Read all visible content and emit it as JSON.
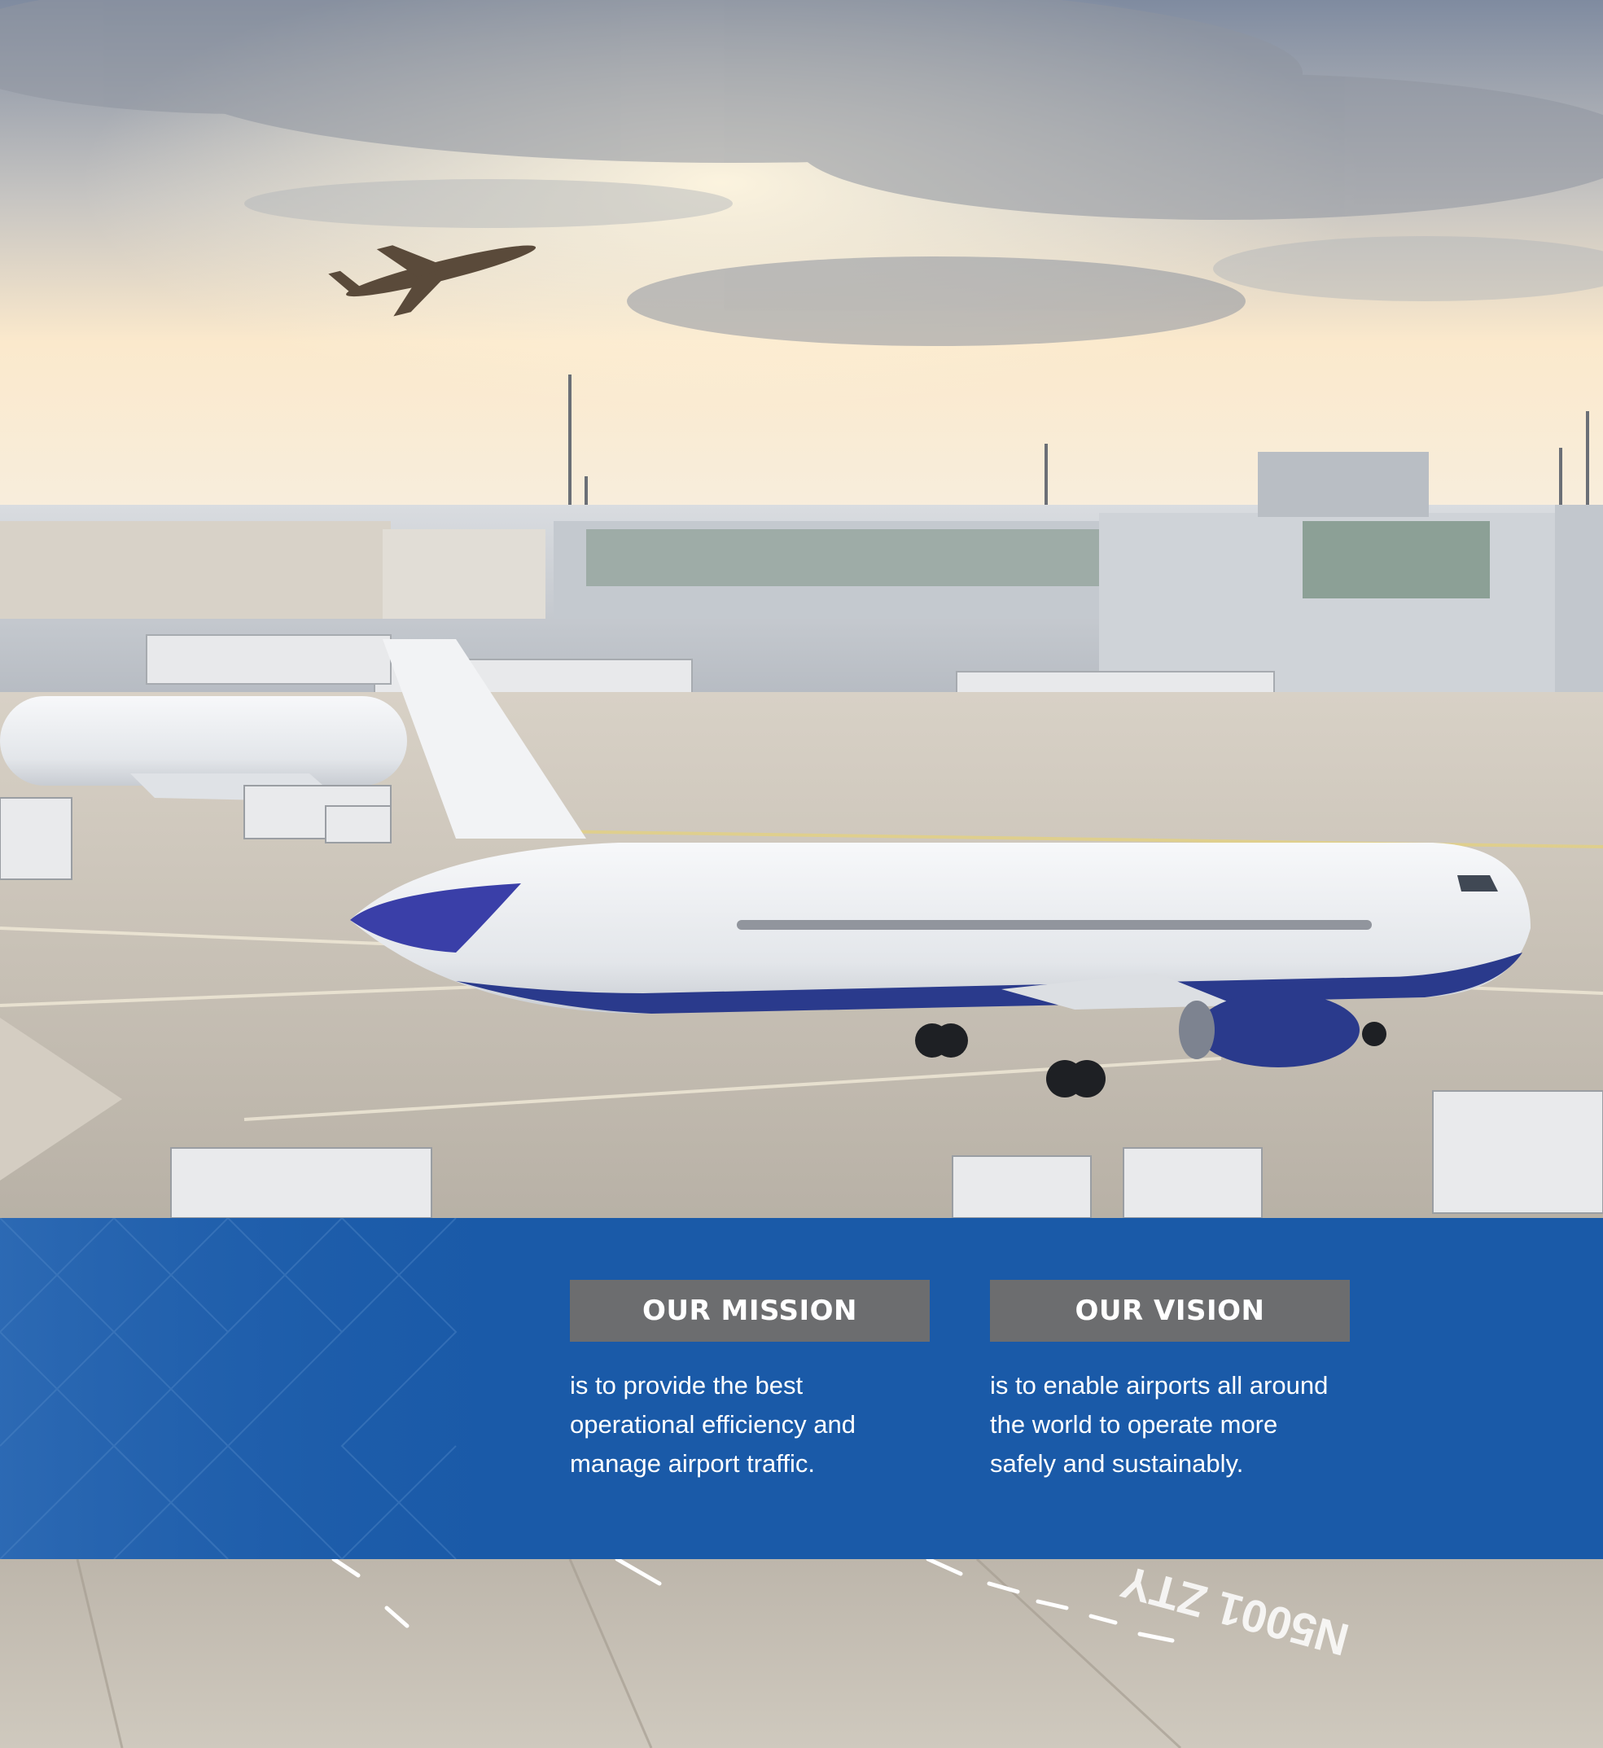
{
  "photo": {
    "scene": "airport-apron-at-sunset",
    "runway_marking_text": "N5001 ZTY",
    "sky_color_top": "#8a94a6",
    "sky_color_glow": "#fbe8c8",
    "apron_color": "#c9c2b6",
    "aircraft_livery_accent": "#2a3a8c"
  },
  "banner": {
    "background_color": "#1a5aa8",
    "heading_bg_color": "#6c6d6f",
    "mission": {
      "heading": "OUR MISSION",
      "text": "is to provide the best operational efficiency and manage airport traffic."
    },
    "vision": {
      "heading": "OUR VISION",
      "text": "is to enable airports all around the world to operate more safely and sustainably."
    }
  }
}
